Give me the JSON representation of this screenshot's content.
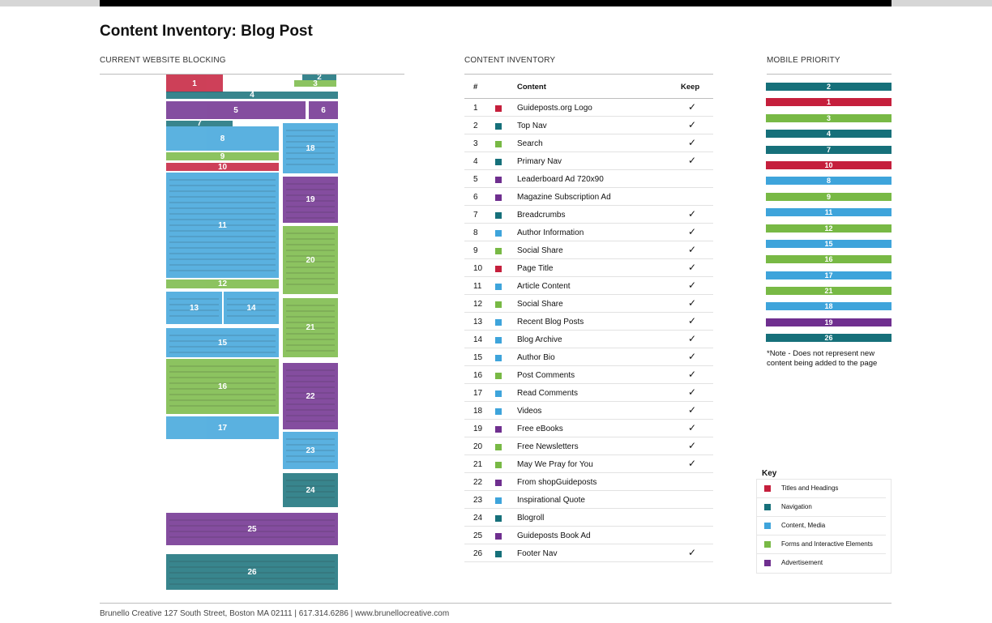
{
  "title": "Content Inventory: Blog Post",
  "sections": {
    "blocking": "CURRENT WEBSITE BLOCKING",
    "inventory": "CONTENT INVENTORY",
    "mobile": "MOBILE PRIORITY"
  },
  "colors": {
    "titles": "#c51f3c",
    "navigation": "#16707a",
    "content": "#3ea4db",
    "forms": "#78b945",
    "ad": "#6f2f8f"
  },
  "table": {
    "headers": {
      "num": "#",
      "content": "Content",
      "keep": "Keep"
    },
    "check_glyph": "✓",
    "rows": [
      {
        "num": "1",
        "label": "Guideposts.org Logo",
        "cat": "titles",
        "keep": true
      },
      {
        "num": "2",
        "label": "Top Nav",
        "cat": "navigation",
        "keep": true
      },
      {
        "num": "3",
        "label": "Search",
        "cat": "forms",
        "keep": true
      },
      {
        "num": "4",
        "label": "Primary Nav",
        "cat": "navigation",
        "keep": true
      },
      {
        "num": "5",
        "label": "Leaderboard Ad 720x90",
        "cat": "ad",
        "keep": false
      },
      {
        "num": "6",
        "label": "Magazine Subscription Ad",
        "cat": "ad",
        "keep": false
      },
      {
        "num": "7",
        "label": "Breadcrumbs",
        "cat": "navigation",
        "keep": true
      },
      {
        "num": "8",
        "label": "Author Information",
        "cat": "content",
        "keep": true
      },
      {
        "num": "9",
        "label": "Social Share",
        "cat": "forms",
        "keep": true
      },
      {
        "num": "10",
        "label": "Page Title",
        "cat": "titles",
        "keep": true
      },
      {
        "num": "11",
        "label": "Article Content",
        "cat": "content",
        "keep": true
      },
      {
        "num": "12",
        "label": "Social Share",
        "cat": "forms",
        "keep": true
      },
      {
        "num": "13",
        "label": "Recent Blog Posts",
        "cat": "content",
        "keep": true
      },
      {
        "num": "14",
        "label": "Blog Archive",
        "cat": "content",
        "keep": true
      },
      {
        "num": "15",
        "label": "Author Bio",
        "cat": "content",
        "keep": true
      },
      {
        "num": "16",
        "label": "Post Comments",
        "cat": "forms",
        "keep": true
      },
      {
        "num": "17",
        "label": "Read Comments",
        "cat": "content",
        "keep": true
      },
      {
        "num": "18",
        "label": "Videos",
        "cat": "content",
        "keep": true
      },
      {
        "num": "19",
        "label": "Free eBooks",
        "cat": "ad",
        "keep": true
      },
      {
        "num": "20",
        "label": "Free Newsletters",
        "cat": "forms",
        "keep": true
      },
      {
        "num": "21",
        "label": "May We Pray for You",
        "cat": "forms",
        "keep": true
      },
      {
        "num": "22",
        "label": "From shopGuideposts",
        "cat": "ad",
        "keep": false
      },
      {
        "num": "23",
        "label": "Inspirational Quote",
        "cat": "content",
        "keep": false
      },
      {
        "num": "24",
        "label": "Blogroll",
        "cat": "navigation",
        "keep": false
      },
      {
        "num": "25",
        "label": "Guideposts Book Ad",
        "cat": "ad",
        "keep": false
      },
      {
        "num": "26",
        "label": "Footer Nav",
        "cat": "navigation",
        "keep": true
      }
    ]
  },
  "mobile_priority": [
    {
      "num": "2",
      "cat": "navigation"
    },
    {
      "num": "1",
      "cat": "titles"
    },
    {
      "num": "3",
      "cat": "forms"
    },
    {
      "num": "4",
      "cat": "navigation"
    },
    {
      "num": "7",
      "cat": "navigation"
    },
    {
      "num": "10",
      "cat": "titles"
    },
    {
      "num": "8",
      "cat": "content"
    },
    {
      "num": "9",
      "cat": "forms"
    },
    {
      "num": "11",
      "cat": "content"
    },
    {
      "num": "12",
      "cat": "forms"
    },
    {
      "num": "15",
      "cat": "content"
    },
    {
      "num": "16",
      "cat": "forms"
    },
    {
      "num": "17",
      "cat": "content"
    },
    {
      "num": "21",
      "cat": "forms"
    },
    {
      "num": "18",
      "cat": "content"
    },
    {
      "num": "19",
      "cat": "ad"
    },
    {
      "num": "26",
      "cat": "navigation"
    }
  ],
  "note": "*Note - Does not represent new content being added to the page",
  "key": {
    "title": "Key",
    "items": [
      {
        "label": "Titles and Headings",
        "cat": "titles"
      },
      {
        "label": "Navigation",
        "cat": "navigation"
      },
      {
        "label": "Content, Media",
        "cat": "content"
      },
      {
        "label": "Forms and Interactive Elements",
        "cat": "forms"
      },
      {
        "label": "Advertisement",
        "cat": "ad"
      }
    ]
  },
  "blocking": {
    "blocks": [
      {
        "num": "1",
        "cat": "titles"
      },
      {
        "num": "2",
        "cat": "navigation"
      },
      {
        "num": "3",
        "cat": "forms"
      },
      {
        "num": "4",
        "cat": "navigation"
      },
      {
        "num": "5",
        "cat": "ad"
      },
      {
        "num": "6",
        "cat": "ad"
      },
      {
        "num": "7",
        "cat": "navigation"
      },
      {
        "num": "8",
        "cat": "content"
      },
      {
        "num": "9",
        "cat": "forms"
      },
      {
        "num": "10",
        "cat": "titles"
      },
      {
        "num": "11",
        "cat": "content"
      },
      {
        "num": "12",
        "cat": "forms"
      },
      {
        "num": "13",
        "cat": "content"
      },
      {
        "num": "14",
        "cat": "content"
      },
      {
        "num": "15",
        "cat": "content"
      },
      {
        "num": "16",
        "cat": "forms"
      },
      {
        "num": "17",
        "cat": "content"
      },
      {
        "num": "18",
        "cat": "content"
      },
      {
        "num": "19",
        "cat": "ad"
      },
      {
        "num": "20",
        "cat": "forms"
      },
      {
        "num": "21",
        "cat": "forms"
      },
      {
        "num": "22",
        "cat": "ad"
      },
      {
        "num": "23",
        "cat": "content"
      },
      {
        "num": "24",
        "cat": "navigation"
      },
      {
        "num": "25",
        "cat": "ad"
      },
      {
        "num": "26",
        "cat": "navigation"
      }
    ]
  },
  "footer": "Brunello Creative 127 South Street, Boston MA 02111 | 617.314.6286 | www.brunellocreative.com"
}
